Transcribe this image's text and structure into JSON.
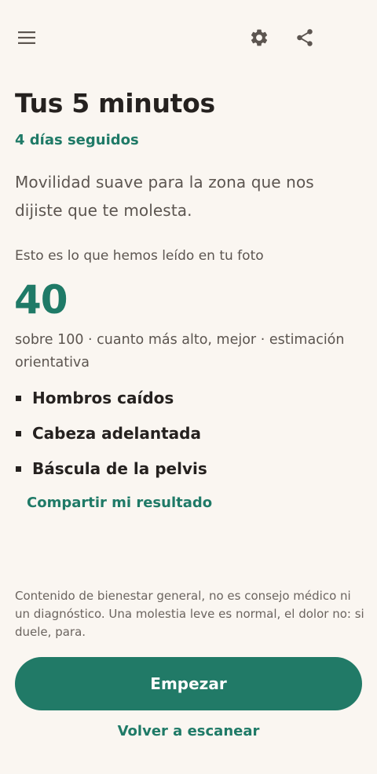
{
  "header": {
    "icons": [
      "menu-icon",
      "settings-icon",
      "share-icon"
    ],
    "icon_color": "#5c5550"
  },
  "routine": {
    "title": "Tus 5 minutos",
    "streak": "4 días seguidos",
    "description": "Movilidad suave para la zona que nos dijiste que te molesta."
  },
  "scan_result": {
    "label": "Esto es lo que hemos leído en tu foto",
    "score": "40",
    "score_note": "sobre 100 · cuanto más alto, mejor · estimación orientativa",
    "findings": [
      {
        "label": "Hombros caídos"
      },
      {
        "label": "Cabeza adelantada"
      },
      {
        "label": "Báscula de la pelvis"
      }
    ],
    "share_label": "Compartir mi resultado"
  },
  "disclaimer": "Contenido de bienestar general, no es consejo médico ni un diagnóstico. Una molestia leve es normal, el dolor no: si duele, para.",
  "actions": {
    "start_label": "Empezar",
    "rescan_label": "Volver a escanear"
  },
  "colors": {
    "background": "#faf6f1",
    "accent": "#1f7a67",
    "primary_button": "#217a67",
    "text_primary": "#25211f",
    "text_secondary": "#5c5550"
  }
}
